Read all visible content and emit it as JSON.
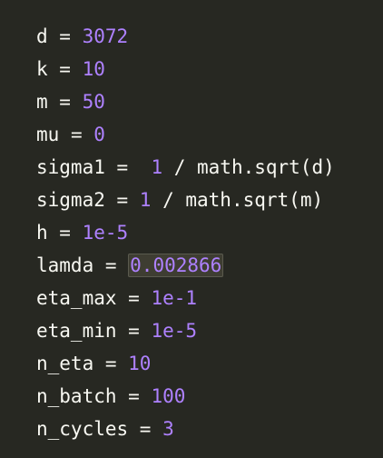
{
  "colors": {
    "background": "#272822",
    "identifier": "#f8f8f2",
    "number": "#ae81ff",
    "highlight_bg": "#3e3d32"
  },
  "lines": [
    {
      "id": "d",
      "name": "d",
      "op": " = ",
      "value": "3072"
    },
    {
      "id": "k",
      "name": "k",
      "op": " = ",
      "value": "10"
    },
    {
      "id": "m",
      "name": "m",
      "op": " = ",
      "value": "50"
    },
    {
      "id": "mu",
      "name": "mu",
      "op": " = ",
      "value": "0"
    },
    {
      "id": "sigma1",
      "name": "sigma1",
      "op": " =  ",
      "value": "1",
      "rest": " / math.sqrt(d)"
    },
    {
      "id": "sigma2",
      "name": "sigma2",
      "op": " = ",
      "value": "1",
      "rest": " / math.sqrt(m)"
    },
    {
      "id": "h",
      "name": "h",
      "op": " = ",
      "value": "1e-5"
    },
    {
      "id": "lamda",
      "name": "lamda",
      "op": " = ",
      "value": "0.002866"
    },
    {
      "id": "eta_max",
      "name": "eta_max",
      "op": " = ",
      "value": "1e-1"
    },
    {
      "id": "eta_min",
      "name": "eta_min",
      "op": " = ",
      "value": "1e-5"
    },
    {
      "id": "n_eta",
      "name": "n_eta",
      "op": " = ",
      "value": "10"
    },
    {
      "id": "n_batch",
      "name": "n_batch",
      "op": " = ",
      "value": "100"
    },
    {
      "id": "n_cycles",
      "name": "n_cycles",
      "op": " = ",
      "value": "3"
    }
  ]
}
